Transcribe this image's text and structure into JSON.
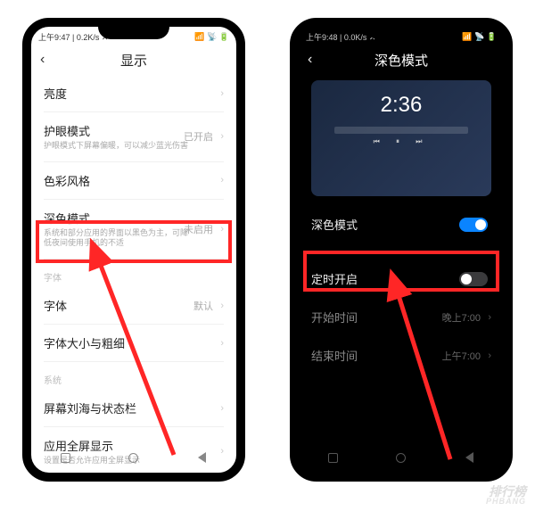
{
  "watermark": {
    "cn": "排行榜",
    "en": "PHBANG"
  },
  "phone1": {
    "status": {
      "time": "上午9:47",
      "net": "0.2K/s",
      "icons": "📶 📡 🔋"
    },
    "header": {
      "title": "显示"
    },
    "rows": {
      "brightness": {
        "title": "亮度"
      },
      "eyecare": {
        "title": "护眼模式",
        "sub": "护眼模式下屏幕偏暖，可以减少蓝光伤害",
        "val": "已开启"
      },
      "colorstyle": {
        "title": "色彩风格"
      },
      "darkmode": {
        "title": "深色模式",
        "sub": "系统和部分应用的界面以黑色为主，可降低夜间使用手机的不适",
        "val": "未启用"
      },
      "section_font": "字体",
      "font": {
        "title": "字体",
        "val": "默认"
      },
      "fontsize": {
        "title": "字体大小与粗细"
      },
      "section_sys": "系统",
      "notchbar": {
        "title": "屏幕刘海与状态栏"
      },
      "fullscreen": {
        "title": "应用全屏显示",
        "sub": "设置是否允许应用全屏显示"
      }
    }
  },
  "phone2": {
    "status": {
      "time": "上午9:48",
      "net": "0.0K/s",
      "icons": "📶 📡 🔋"
    },
    "header": {
      "title": "深色模式"
    },
    "preview": {
      "clock": "2:36"
    },
    "rows": {
      "darkmode": {
        "title": "深色模式"
      },
      "schedule": {
        "title": "定时开启"
      },
      "start": {
        "title": "开始时间",
        "val": "晚上7:00"
      },
      "end": {
        "title": "结束时间",
        "val": "上午7:00"
      }
    }
  }
}
